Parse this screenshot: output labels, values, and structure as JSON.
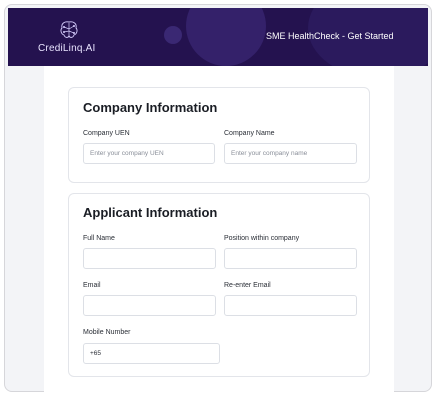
{
  "app": {
    "logo_text": "CrediLinq.AI",
    "nav_title": "SME HealthCheck - Get Started"
  },
  "company_section": {
    "title": "Company Information",
    "fields": {
      "uen": {
        "label": "Company UEN",
        "placeholder": "Enter your company UEN",
        "value": ""
      },
      "name": {
        "label": "Company Name",
        "placeholder": "Enter your company name",
        "value": ""
      }
    }
  },
  "applicant_section": {
    "title": "Applicant Information",
    "fields": {
      "full_name": {
        "label": "Full Name",
        "value": ""
      },
      "position": {
        "label": "Position within company",
        "value": ""
      },
      "email": {
        "label": "Email",
        "value": ""
      },
      "reenter_email": {
        "label": "Re-enter Email",
        "value": ""
      },
      "mobile": {
        "label": "Mobile Number",
        "value": "+65"
      }
    }
  },
  "colors": {
    "navbar": "#24124f",
    "page_background": "#f3f4f7",
    "card_border": "#e3e5ea"
  },
  "icons": {
    "logo": "brain-circuit-icon"
  }
}
